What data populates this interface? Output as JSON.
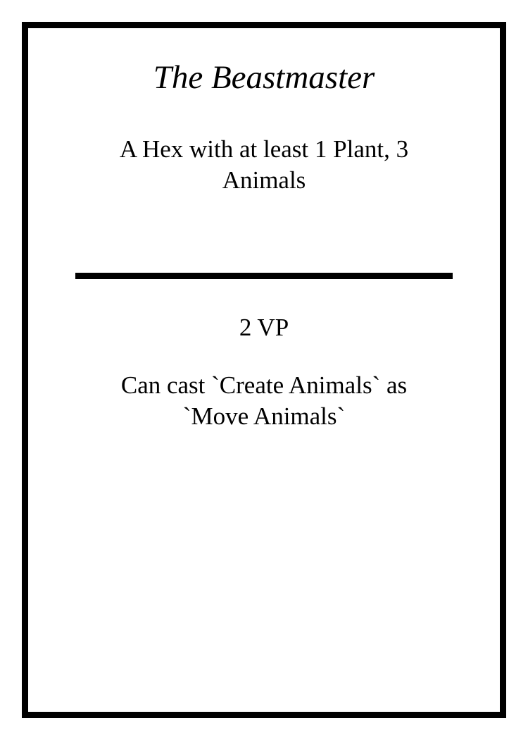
{
  "card": {
    "title": "The Beastmaster",
    "requirement": "A Hex with at least 1 Plant, 3 Animals",
    "victory_points": "2 VP",
    "ability": "Can cast `Create Animals` as `Move Animals`"
  }
}
